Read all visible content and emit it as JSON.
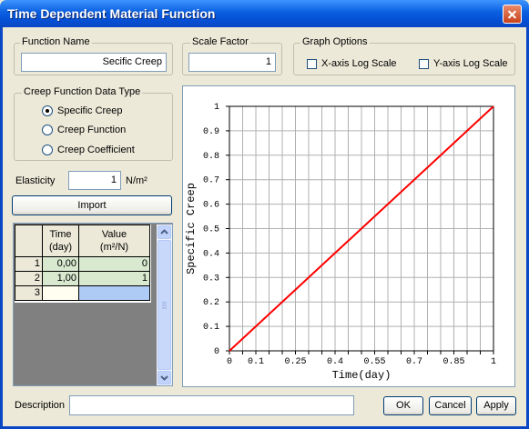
{
  "window": {
    "title": "Time Dependent Material Function"
  },
  "function_name": {
    "label": "Function Name",
    "value": "Secific Creep"
  },
  "scale_factor": {
    "label": "Scale Factor",
    "value": "1"
  },
  "graph_options": {
    "label": "Graph Options",
    "x_log_label": "X-axis Log Scale",
    "y_log_label": "Y-axis Log Scale",
    "x_log_checked": false,
    "y_log_checked": false
  },
  "creep_type": {
    "label": "Creep Function Data Type",
    "options": [
      {
        "label": "Specific Creep",
        "selected": true
      },
      {
        "label": "Creep Function",
        "selected": false
      },
      {
        "label": "Creep Coefficient",
        "selected": false
      }
    ]
  },
  "elasticity": {
    "label": "Elasticity",
    "value": "1",
    "unit": "N/m²"
  },
  "import_button": "Import",
  "table": {
    "headers": [
      {
        "line1": "Time",
        "line2": "(day)"
      },
      {
        "line1": "Value",
        "line2": "(m²/N)"
      }
    ],
    "rows": [
      {
        "num": "1",
        "time": "0,00",
        "value": "0"
      },
      {
        "num": "2",
        "time": "1,00",
        "value": "1"
      },
      {
        "num": "3",
        "time": "",
        "value": ""
      }
    ]
  },
  "description": {
    "label": "Description",
    "value": ""
  },
  "buttons": {
    "ok": "OK",
    "cancel": "Cancel",
    "apply": "Apply"
  },
  "chart_data": {
    "type": "line",
    "xlabel": "Time(day)",
    "ylabel": "Specific Creep",
    "xlim": [
      0,
      1
    ],
    "ylim": [
      0,
      1
    ],
    "x_ticks": [
      "0",
      "0.1",
      "0.25",
      "0.4",
      "0.55",
      "0.7",
      "0.85",
      "1"
    ],
    "x_tick_values": [
      0,
      0.1,
      0.25,
      0.4,
      0.55,
      0.7,
      0.85,
      1
    ],
    "y_ticks": [
      "0",
      "0.1",
      "0.2",
      "0.3",
      "0.4",
      "0.5",
      "0.6",
      "0.7",
      "0.8",
      "0.9",
      "1"
    ],
    "y_tick_values": [
      0,
      0.1,
      0.2,
      0.3,
      0.4,
      0.5,
      0.6,
      0.7,
      0.8,
      0.9,
      1
    ],
    "grid": true,
    "series": [
      {
        "x": [
          0,
          1
        ],
        "y": [
          0,
          1
        ],
        "color": "#ff0000"
      }
    ]
  }
}
